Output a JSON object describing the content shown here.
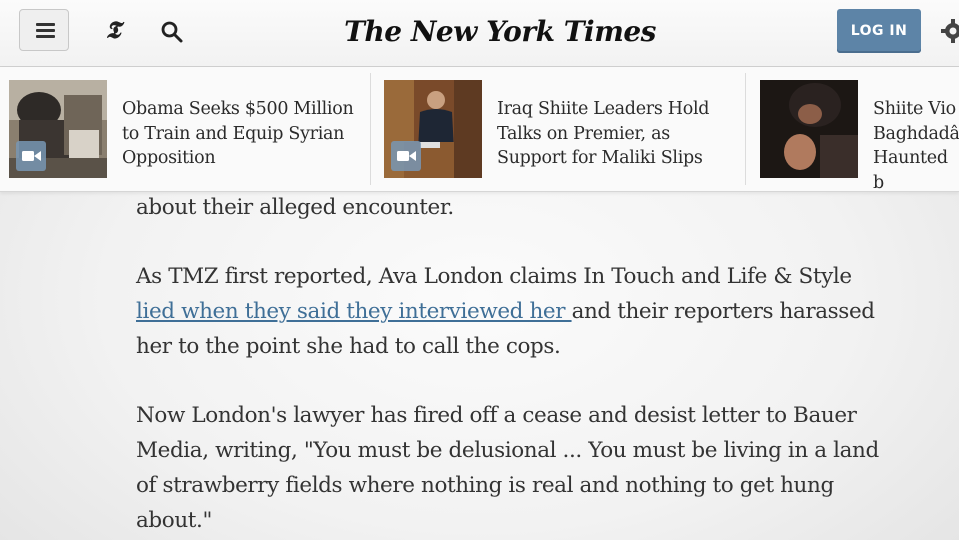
{
  "header": {
    "masthead": "The New York Times",
    "t_logo": "𝕿",
    "login_label": "LOG IN",
    "icons": [
      "menu-icon",
      "nyt-t-icon",
      "search-icon",
      "gear-icon"
    ]
  },
  "strip": {
    "stories": [
      {
        "headline": "Obama Seeks $500 Million to Train and Equip Syrian Opposition",
        "icon": "video-icon"
      },
      {
        "headline": "Iraq Shiite Leaders Hold Talks on Premier, as Support for Maliki Slips",
        "icon": "video-icon"
      },
      {
        "headline": "Shiite Vio Baghdadâ Haunted b",
        "icon": ""
      }
    ]
  },
  "article": {
    "line1": "about their alleged encounter.",
    "p2_start": "As TMZ first reported, Ava London claims In Touch and Life & Style",
    "p2_link": "lied when they said they interviewed her ",
    "p2_rest": "and their reporters harassed her to the point she had to call the cops.",
    "p3": "Now London's lawyer has fired off a cease and desist letter to Bauer Media, writing, \"You must be delusional ... You must be living in a land of strawberry fields where nothing is real and nothing to get hung about.\""
  },
  "colors": {
    "login_bg": "#5d84a7",
    "link": "#3f6f97",
    "text": "#333333"
  }
}
